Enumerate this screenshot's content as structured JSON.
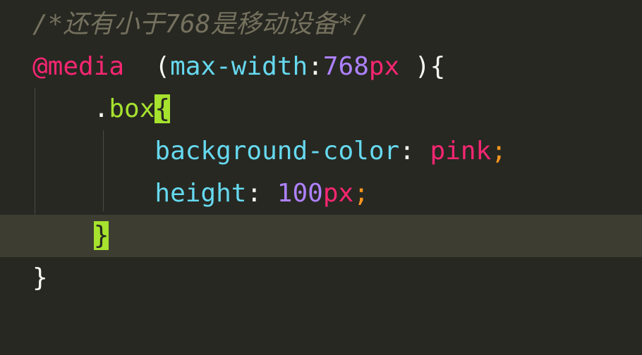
{
  "editor": {
    "colors": {
      "background": "#272822",
      "current_line": "#3e3d32",
      "comment": "#75715e",
      "keyword": "#f92672",
      "property": "#66d9ef",
      "number": "#ae81ff",
      "selector": "#a6e22e",
      "punctuation": "#f8f8f2",
      "semicolon": "#fd971f",
      "bracket_match": "#a6e22e"
    },
    "lines": [
      {
        "tokens": [
          {
            "text": "/*还有小于768是移动设备*/",
            "type": "comment"
          }
        ]
      },
      {
        "tokens": [
          {
            "text": "@media",
            "type": "keyword"
          },
          {
            "text": "  (",
            "type": "punctuation"
          },
          {
            "text": "max-width",
            "type": "property"
          },
          {
            "text": ":",
            "type": "punctuation"
          },
          {
            "text": "768",
            "type": "number"
          },
          {
            "text": "px",
            "type": "keyword"
          },
          {
            "text": " ){",
            "type": "punctuation"
          }
        ]
      },
      {
        "tokens": [
          {
            "text": "    .",
            "type": "punctuation"
          },
          {
            "text": "box",
            "type": "selector"
          },
          {
            "text": "{",
            "type": "bracket"
          }
        ]
      },
      {
        "tokens": [
          {
            "text": "        background-color",
            "type": "property"
          },
          {
            "text": ": ",
            "type": "punctuation"
          },
          {
            "text": "pink",
            "type": "keyword"
          },
          {
            "text": ";",
            "type": "semicolon"
          }
        ]
      },
      {
        "tokens": [
          {
            "text": "        height",
            "type": "property"
          },
          {
            "text": ": ",
            "type": "punctuation"
          },
          {
            "text": "100",
            "type": "number"
          },
          {
            "text": "px",
            "type": "keyword"
          },
          {
            "text": ";",
            "type": "semicolon"
          }
        ]
      },
      {
        "current": true,
        "tokens": [
          {
            "text": "    ",
            "type": "punctuation"
          },
          {
            "text": "}",
            "type": "bracket"
          }
        ]
      },
      {
        "tokens": [
          {
            "text": "}",
            "type": "punctuation"
          }
        ]
      }
    ]
  }
}
